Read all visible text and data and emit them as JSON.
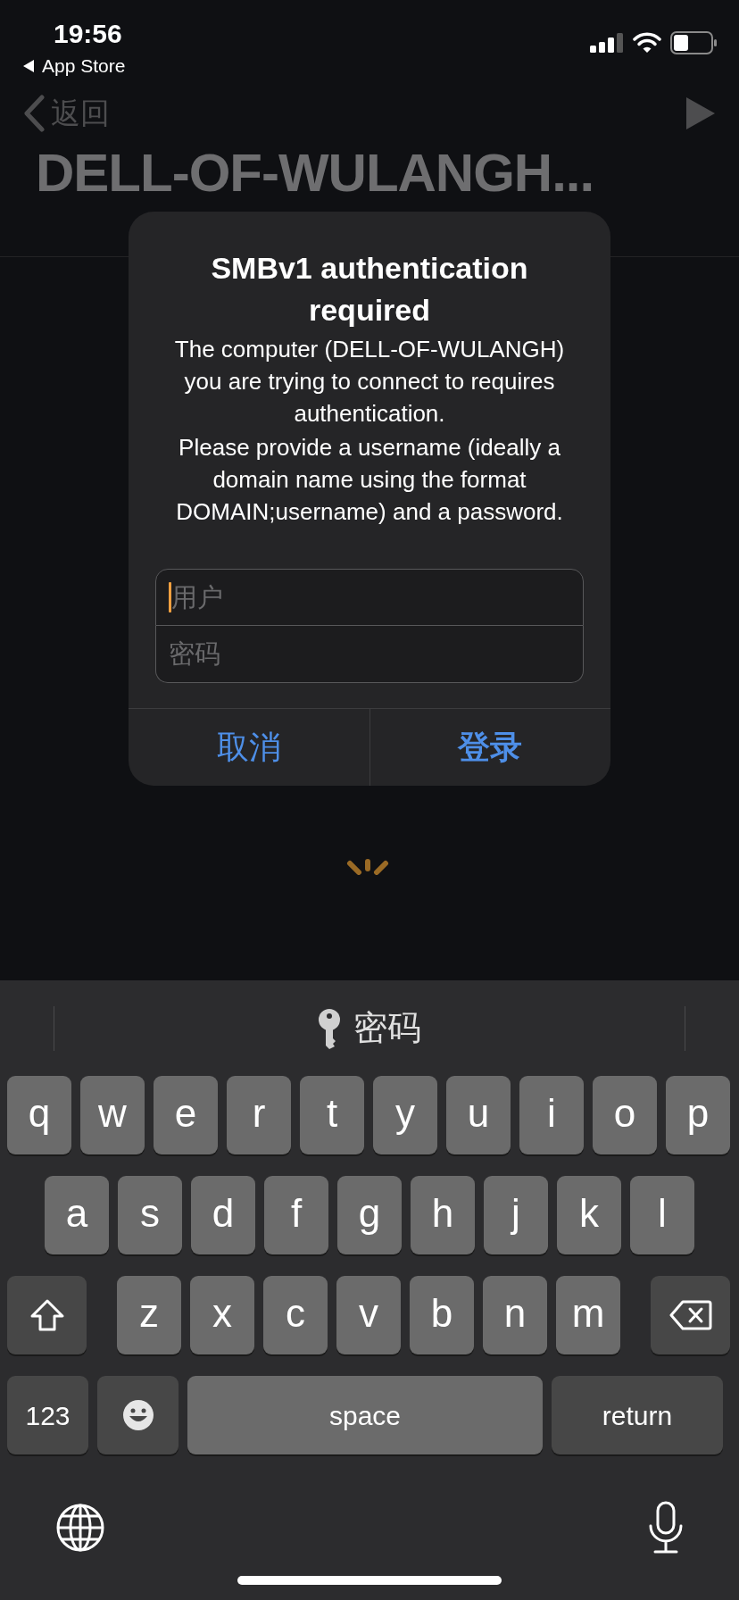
{
  "status_bar": {
    "time": "19:56",
    "back_app": "App Store"
  },
  "nav": {
    "back_label": "返回",
    "title": "DELL-OF-WULANGH..."
  },
  "dialog": {
    "title": "SMBv1 authentication required",
    "message": [
      "The computer (DELL-OF-WULANGH) you are trying to connect to requires authentication.",
      "Please provide a username (ideally a domain name using the format DOMAIN;username) and a password."
    ],
    "fields": [
      {
        "placeholder": "用户",
        "focused": true
      },
      {
        "placeholder": "密码",
        "focused": false
      }
    ],
    "buttons": [
      {
        "label": "取消",
        "kind": "cancel"
      },
      {
        "label": "登录",
        "kind": "default"
      }
    ]
  },
  "keyboard": {
    "suggestion": "密码",
    "rows": [
      [
        {
          "kind": "letter",
          "label": "q"
        },
        {
          "kind": "letter",
          "label": "w"
        },
        {
          "kind": "letter",
          "label": "e"
        },
        {
          "kind": "letter",
          "label": "r"
        },
        {
          "kind": "letter",
          "label": "t"
        },
        {
          "kind": "letter",
          "label": "y"
        },
        {
          "kind": "letter",
          "label": "u"
        },
        {
          "kind": "letter",
          "label": "i"
        },
        {
          "kind": "letter",
          "label": "o"
        },
        {
          "kind": "letter",
          "label": "p"
        }
      ],
      [
        {
          "kind": "letter",
          "label": "a"
        },
        {
          "kind": "letter",
          "label": "s"
        },
        {
          "kind": "letter",
          "label": "d"
        },
        {
          "kind": "letter",
          "label": "f"
        },
        {
          "kind": "letter",
          "label": "g"
        },
        {
          "kind": "letter",
          "label": "h"
        },
        {
          "kind": "letter",
          "label": "j"
        },
        {
          "kind": "letter",
          "label": "k"
        },
        {
          "kind": "letter",
          "label": "l"
        }
      ],
      [
        {
          "kind": "shift"
        },
        {
          "kind": "letter",
          "label": "z"
        },
        {
          "kind": "letter",
          "label": "x"
        },
        {
          "kind": "letter",
          "label": "c"
        },
        {
          "kind": "letter",
          "label": "v"
        },
        {
          "kind": "letter",
          "label": "b"
        },
        {
          "kind": "letter",
          "label": "n"
        },
        {
          "kind": "letter",
          "label": "m"
        },
        {
          "kind": "backspace"
        }
      ]
    ],
    "bottom_row": [
      {
        "kind": "numbers",
        "label": "123"
      },
      {
        "kind": "emoji"
      },
      {
        "kind": "space",
        "label": "space"
      },
      {
        "kind": "return",
        "label": "return"
      }
    ]
  }
}
